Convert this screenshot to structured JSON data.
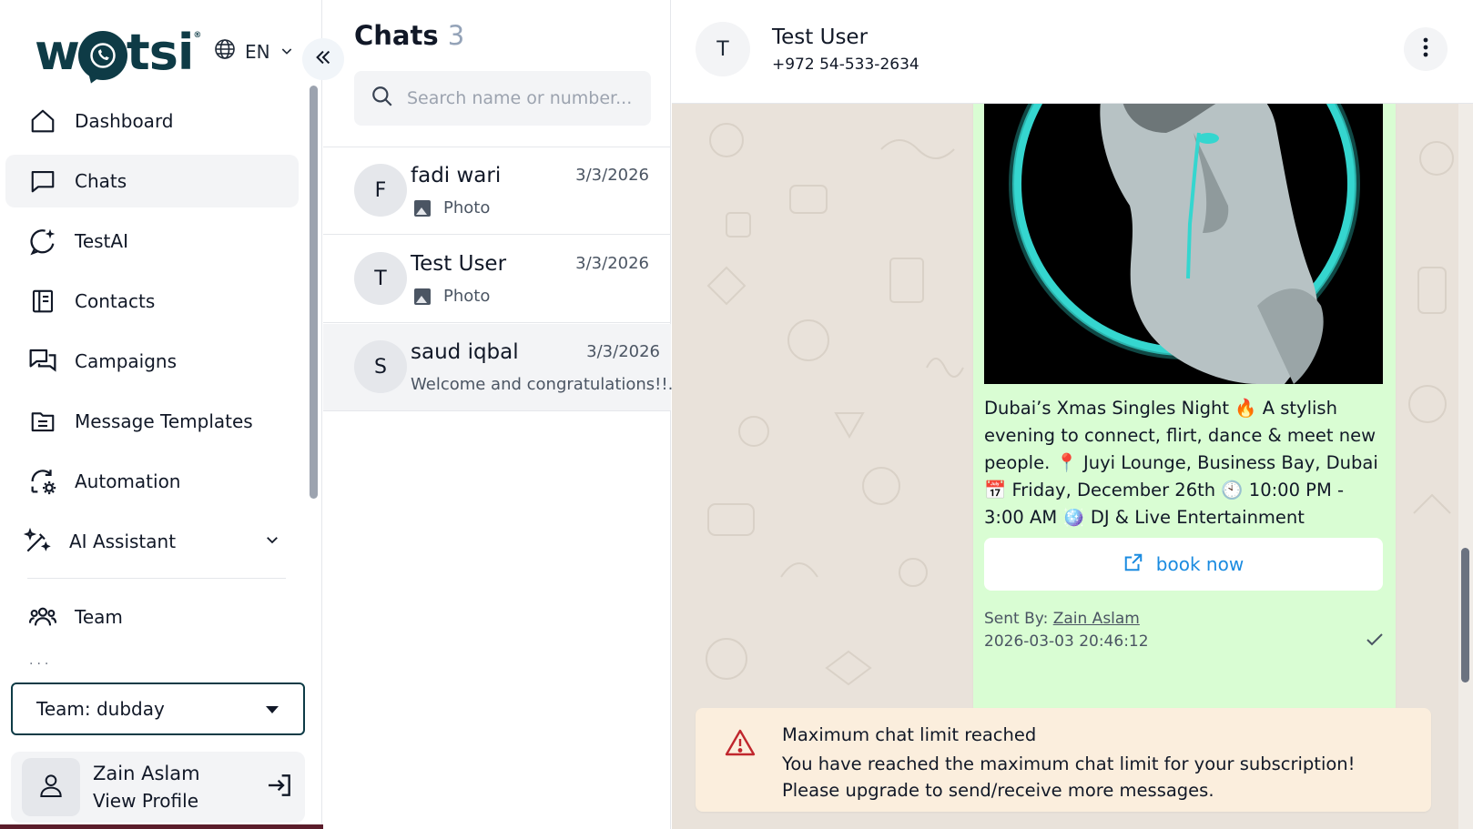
{
  "sidebar": {
    "logo_text": "wotsi",
    "language": "EN",
    "nav": [
      {
        "label": "Dashboard"
      },
      {
        "label": "Chats"
      },
      {
        "label": "TestAI"
      },
      {
        "label": "Contacts"
      },
      {
        "label": "Campaigns"
      },
      {
        "label": "Message Templates"
      },
      {
        "label": "Automation"
      },
      {
        "label": "AI Assistant"
      }
    ],
    "team_item": "Team",
    "more_dots": "...",
    "team_select": "Team: dubday",
    "profile": {
      "name": "Zain Aslam",
      "link": "View Profile"
    }
  },
  "chatlist": {
    "title": "Chats",
    "count": "3",
    "search_placeholder": "Search name or number...",
    "chats": [
      {
        "avatar": "F",
        "name": "fadi wari",
        "date": "3/3/2026",
        "preview": "Photo"
      },
      {
        "avatar": "T",
        "name": "Test User",
        "date": "3/3/2026",
        "preview": "Photo"
      },
      {
        "avatar": "S",
        "name": "saud iqbal",
        "date": "3/3/2026",
        "preview": "Welcome and congratulations!!..."
      }
    ]
  },
  "conversation": {
    "avatar": "T",
    "name": "Test User",
    "phone": "+972 54-533-2634",
    "message": {
      "caption": "Dubai’s Xmas Singles Night 🔥 A stylish evening to connect, flirt, dance & meet new people. 📍 Juyi Lounge, Business Bay, Dubai 📅 Friday, December 26th 🕙 10:00 PM - 3:00 AM 🪩 DJ & Live Entertainment",
      "button_label": "book now",
      "sent_by_label": "Sent By:",
      "sent_by_name": "Zain Aslam",
      "timestamp": "2026-03-03 20:46:12"
    },
    "alert": {
      "title": "Maximum chat limit reached",
      "message": "You have reached the maximum chat limit for your subscription! Please upgrade to send/receive more messages."
    }
  },
  "colors": {
    "brand": "#0e3b46",
    "chat_bg": "#e9e2da",
    "bubble": "#d9fdd3",
    "alert_bg": "#fbeedd",
    "alert_icon": "#c0262d",
    "link_blue": "#1a8be0",
    "image_glow": "#35d6cf"
  }
}
